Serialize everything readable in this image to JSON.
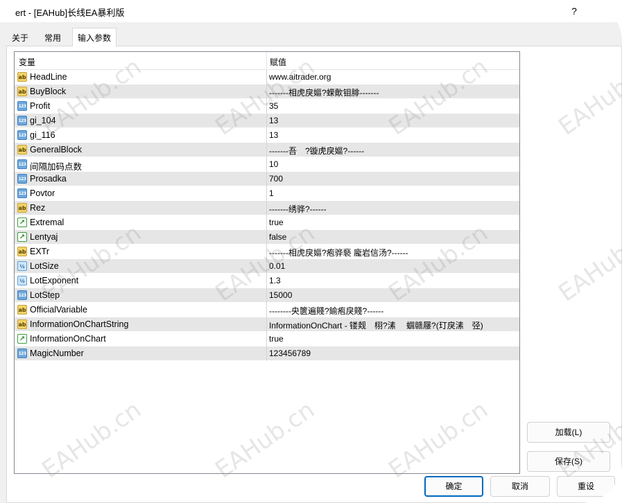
{
  "window": {
    "title": "ert - [EAHub]长线EA暴利版",
    "help": "?"
  },
  "tabs": [
    {
      "label": "关于"
    },
    {
      "label": "常用"
    },
    {
      "label": "输入参数",
      "active": true
    }
  ],
  "grid": {
    "col_variable": "变量",
    "col_value": "赋值",
    "rows": [
      {
        "type": "string",
        "icon": "string-icon",
        "name": "HeadLine",
        "value": "www.aitrader.org"
      },
      {
        "type": "string",
        "icon": "string-icon",
        "name": "BuyBlock",
        "value": "-------相虎戾嫗?蝾歕钼腓-------"
      },
      {
        "type": "int",
        "icon": "integer-icon",
        "name": "Profit",
        "value": "35"
      },
      {
        "type": "int",
        "icon": "integer-icon",
        "name": "gi_104",
        "value": "13"
      },
      {
        "type": "int",
        "icon": "integer-icon",
        "name": "gi_116",
        "value": "13"
      },
      {
        "type": "string",
        "icon": "string-icon",
        "name": "GeneralBlock",
        "value": "-------吾　?镟虎戾嫗?------"
      },
      {
        "type": "int",
        "icon": "integer-icon",
        "name": "间隔加码点数",
        "value": "10"
      },
      {
        "type": "int",
        "icon": "integer-icon",
        "name": "Prosadka",
        "value": "700"
      },
      {
        "type": "int",
        "icon": "integer-icon",
        "name": "Povtor",
        "value": "1"
      },
      {
        "type": "string",
        "icon": "string-icon",
        "name": "Rez",
        "value": "-------绣骅?------"
      },
      {
        "type": "bool",
        "icon": "boolean-icon",
        "name": "Extremal",
        "value": "true"
      },
      {
        "type": "bool",
        "icon": "boolean-icon",
        "name": "Lentyaj",
        "value": "false"
      },
      {
        "type": "string",
        "icon": "string-icon",
        "name": "EXTr",
        "value": "-------相虎戾嫗?疱骅褻 龐岩信汤?------"
      },
      {
        "type": "double",
        "icon": "double-icon",
        "name": "LotSize",
        "value": "0.01"
      },
      {
        "type": "double",
        "icon": "double-icon",
        "name": "LotExponent",
        "value": "1.3"
      },
      {
        "type": "int",
        "icon": "integer-icon",
        "name": "LotStep",
        "value": "15000"
      },
      {
        "type": "string",
        "icon": "string-icon",
        "name": "OfficialVariable",
        "value": "--------央篋遍賤?鍮疱戾賤?------"
      },
      {
        "type": "string",
        "icon": "string-icon",
        "name": "InformationOnChartString",
        "value": "InformationOnChart - 镂觌　栩?溸　 蝈赣屦?(玎戾溸　弪)"
      },
      {
        "type": "bool",
        "icon": "boolean-icon",
        "name": "InformationOnChart",
        "value": "true"
      },
      {
        "type": "int",
        "icon": "integer-icon",
        "name": "MagicNumber",
        "value": "123456789"
      }
    ]
  },
  "icons": {
    "string": "ab",
    "int": "123",
    "bool": "↗",
    "double": "½"
  },
  "buttons": {
    "load": "加载(L)",
    "save": "保存(S)",
    "ok": "确定",
    "cancel": "取消",
    "reset": "重设"
  },
  "watermark_text": "EAHub.cn",
  "colors": {
    "alt_row": "#e6e6e6",
    "ok_border": "#0067c0"
  }
}
